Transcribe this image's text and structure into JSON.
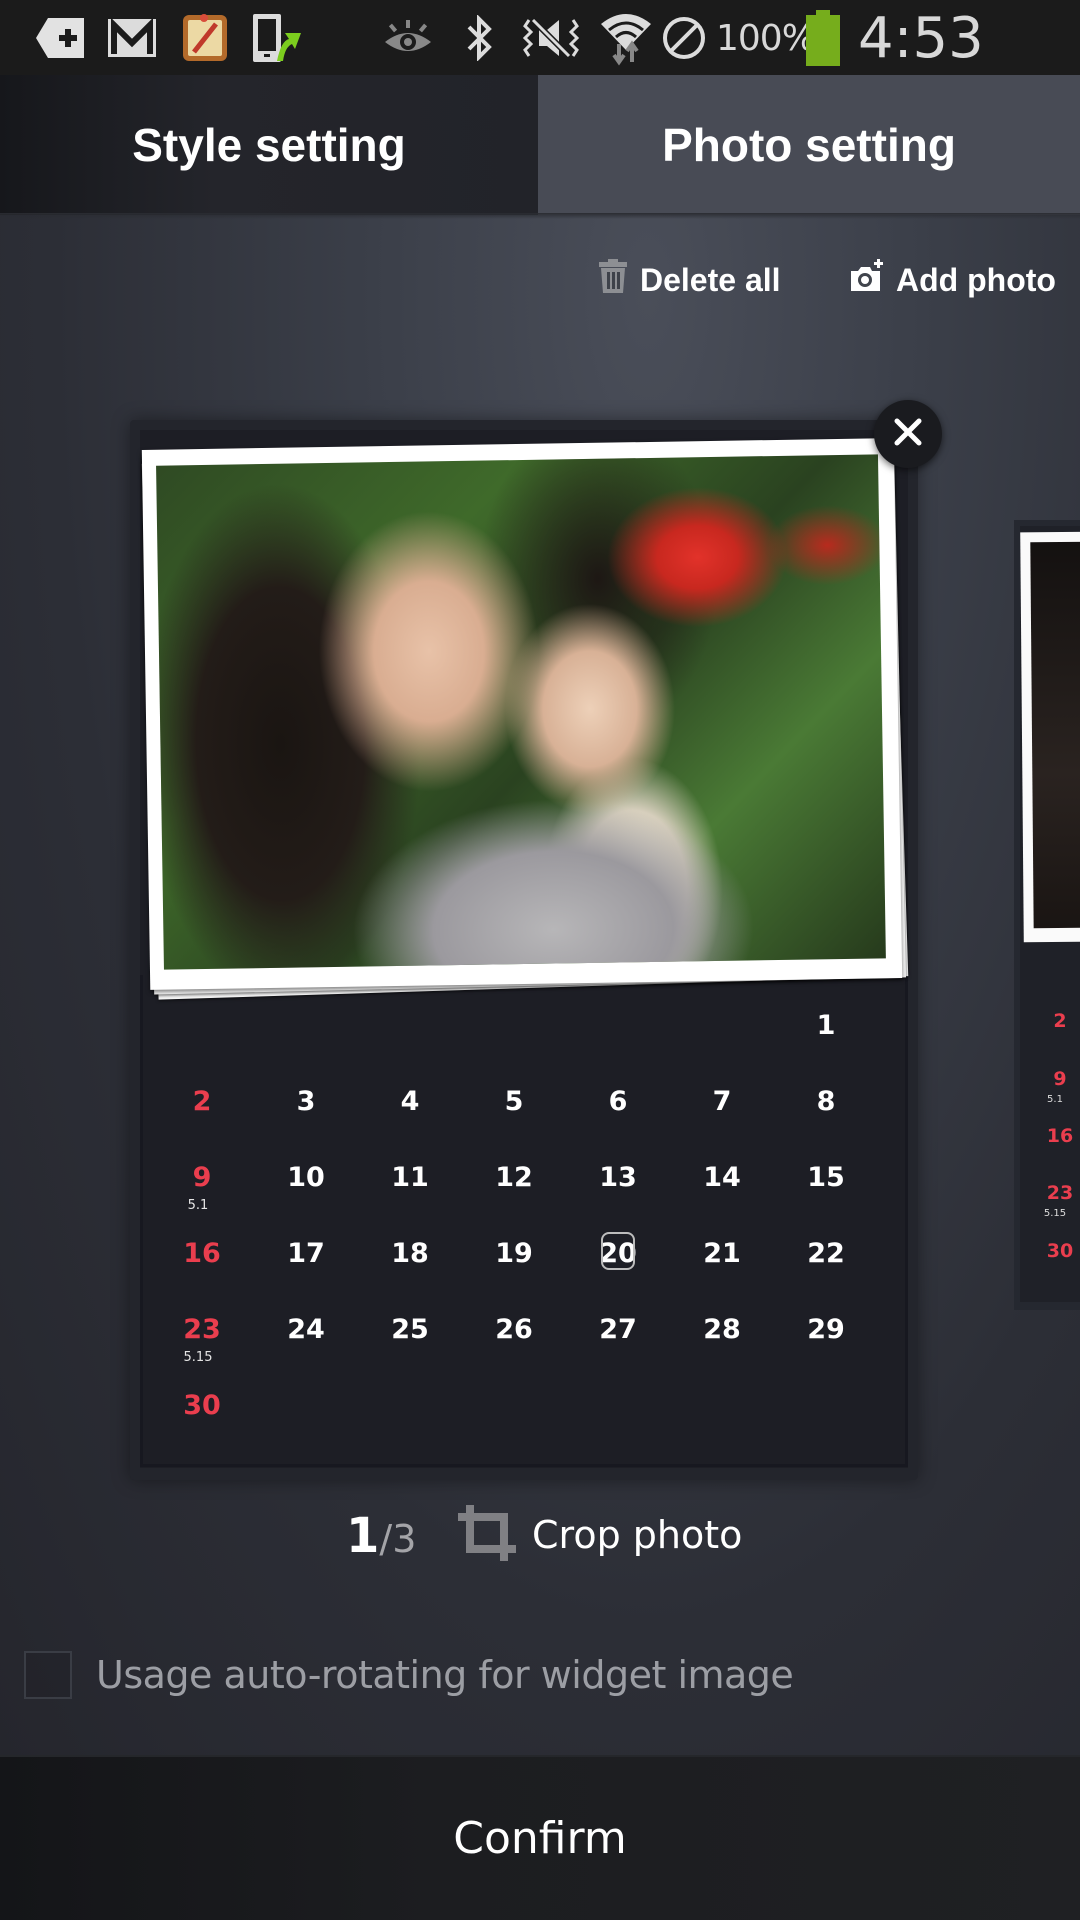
{
  "status_bar": {
    "left_icons": [
      "bookmark-plus-icon",
      "gmail-icon",
      "notes-app-icon",
      "phone-upload-icon"
    ],
    "right_icons": [
      "smart-stay-eye-icon",
      "bluetooth-icon",
      "vibrate-mute-icon",
      "wifi-data-icon",
      "no-sim-icon"
    ],
    "battery_percent": "100%",
    "battery_level": 1.0,
    "battery_color": "#76ad1c",
    "time": "4:53 PM"
  },
  "tabs": [
    {
      "label": "Style setting",
      "selected": false
    },
    {
      "label": "Photo setting",
      "selected": true
    }
  ],
  "actions": {
    "delete_all": "Delete all",
    "add_photo": "Add photo"
  },
  "calendar": {
    "weeks": [
      [
        null,
        null,
        null,
        null,
        null,
        null,
        "1"
      ],
      [
        "2",
        "3",
        "4",
        "5",
        "6",
        "7",
        "8"
      ],
      [
        "9",
        "10",
        "11",
        "12",
        "13",
        "14",
        "15"
      ],
      [
        "16",
        "17",
        "18",
        "19",
        "20",
        "21",
        "22"
      ],
      [
        "23",
        "24",
        "25",
        "26",
        "27",
        "28",
        "29"
      ],
      [
        "30",
        null,
        null,
        null,
        null,
        null,
        null
      ]
    ],
    "subtexts": {
      "9": "5.1",
      "23": "5.15"
    },
    "today": "20",
    "sunday_color": "#ea3e4e"
  },
  "peek_calendar": {
    "days": [
      "2",
      "9",
      "16",
      "23",
      "30"
    ],
    "subtexts": {
      "9": "5.1",
      "23": "5.15"
    }
  },
  "pager": {
    "current": "1",
    "total": "/3"
  },
  "crop_photo": "Crop photo",
  "auto_rotate": {
    "label": "Usage auto-rotating for widget image",
    "checked": false
  },
  "confirm": "Confirm"
}
